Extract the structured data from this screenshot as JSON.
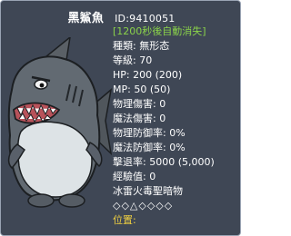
{
  "monster": {
    "name": "黑鯊魚",
    "id_text": "ID:9410051",
    "note": "[1200秒後自動消失]",
    "stats": [
      "種類: 無形态",
      "等級: 70",
      "HP: 200 (200)",
      "MP: 50 (50)",
      "物理傷害: 0",
      "魔法傷害: 0",
      "物理防御率: 0%",
      "魔法防御率: 0%",
      "擊退率: 5000 (5,000)",
      "經驗值: 0"
    ],
    "elements_label": "冰雷火毒聖暗物",
    "elements_icons": "◇◇△◇◇◇◇",
    "location_label": "位置:"
  },
  "colors": {
    "background": "#3f4755",
    "note": "#8ad24a",
    "location": "#f0d040",
    "text": "#ffffff"
  },
  "icons": [
    "shark-portrait"
  ]
}
